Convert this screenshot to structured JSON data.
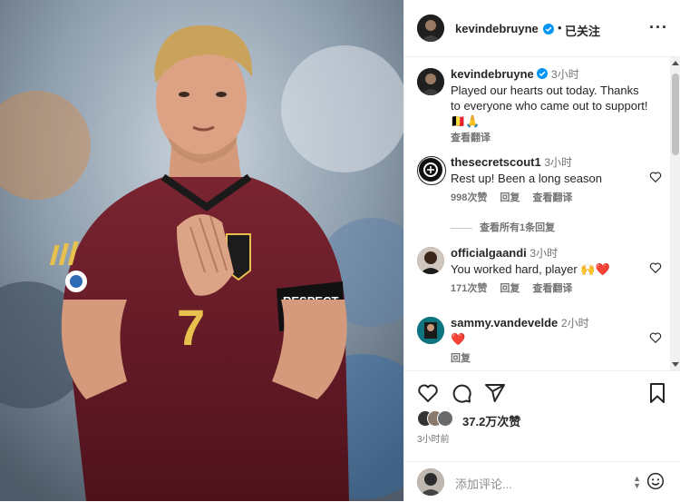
{
  "post": {
    "username": "kevindebruyne",
    "follow_label": "已关注",
    "more_label": "···"
  },
  "caption": {
    "username": "kevindebruyne",
    "time": "3小时",
    "text": "Played our hearts out today. Thanks to everyone who came out to support! ",
    "emoji": "🇧🇪🙏",
    "translate": "查看翻译"
  },
  "comments": [
    {
      "username": "thesecretscout1",
      "time": "3小时",
      "text": "Rest up! Been a long season",
      "likes": "998次赞",
      "reply": "回复",
      "translate": "查看翻译"
    },
    {
      "username": "officialgaandi",
      "time": "3小时",
      "text": "You worked hard, player ",
      "emoji": "🙌❤️",
      "likes": "171次赞",
      "reply": "回复",
      "translate": "查看翻译"
    },
    {
      "username": "sammy.vandevelde",
      "time": "2小时",
      "text": "❤️",
      "reply": "回复"
    }
  ],
  "view_replies": "查看所有1条回复",
  "likes_count": "37.2万次赞",
  "posted_ago": "3小时前",
  "add_comment_placeholder": "添加评论...",
  "colors": {
    "verified": "#0095f6",
    "heart": "#ed4956",
    "jersey": "#6b1f2a"
  },
  "icons": [
    "more-icon",
    "verified-icon",
    "heart-icon",
    "comment-icon",
    "share-icon",
    "bookmark-icon",
    "emoji-icon"
  ]
}
